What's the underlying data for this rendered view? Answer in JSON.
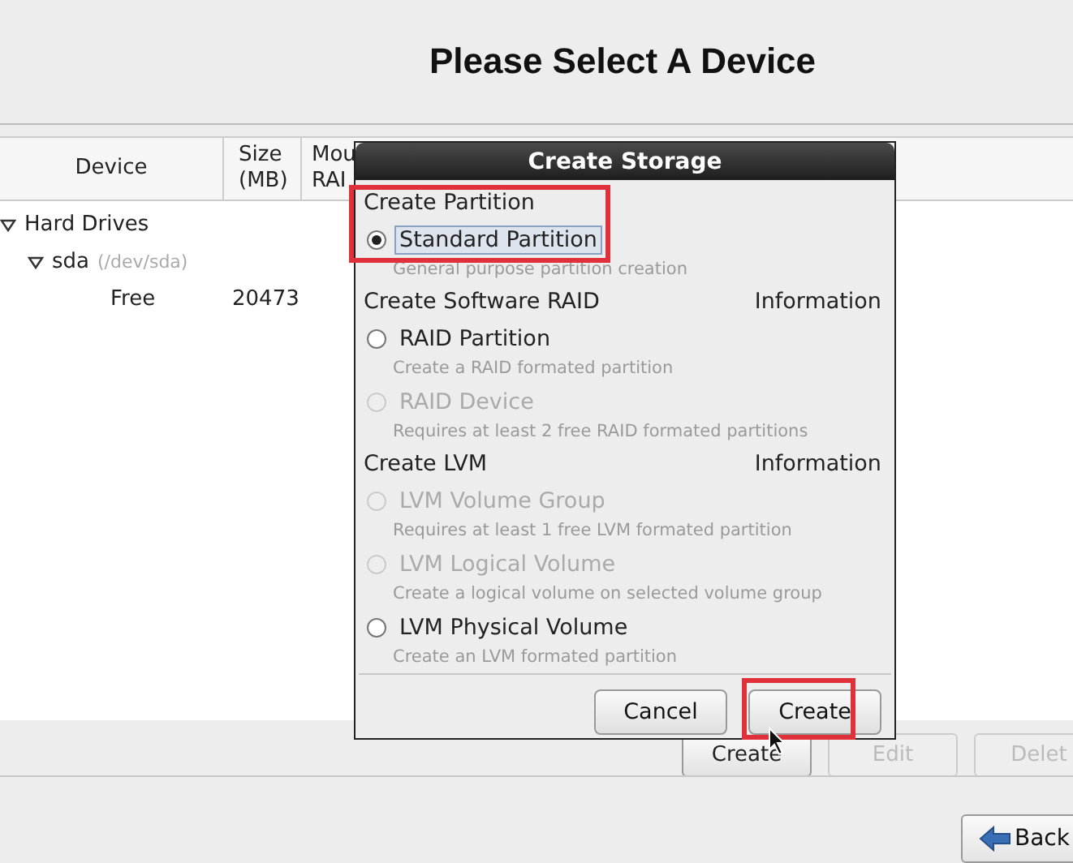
{
  "header": {
    "title": "Please Select A Device"
  },
  "table": {
    "columns": [
      {
        "lines": [
          "Device"
        ]
      },
      {
        "lines": [
          "Size",
          "(MB)"
        ]
      },
      {
        "lines": [
          "Mou",
          "RAI"
        ]
      }
    ],
    "rows": [
      {
        "label": "Hard Drives",
        "expanded": true,
        "children": [
          {
            "label": "sda",
            "detail": "(/dev/sda)",
            "expanded": true,
            "children": [
              {
                "label": "Free",
                "size": "20473"
              }
            ]
          }
        ]
      }
    ]
  },
  "actions": [
    {
      "label": "Create",
      "disabled": false
    },
    {
      "label": "Edit",
      "disabled": true
    },
    {
      "label": "Delet",
      "disabled": true
    }
  ],
  "nav": {
    "back": "Back"
  },
  "dialog": {
    "title": "Create Storage",
    "sections": [
      {
        "heading": "Create Partition",
        "options": [
          {
            "label": "Standard Partition",
            "description": "General purpose partition creation",
            "selected": true,
            "disabled": false,
            "highlighted": true
          }
        ]
      },
      {
        "heading": "Create Software RAID",
        "info": "Information",
        "options": [
          {
            "label": "RAID Partition",
            "description": "Create a RAID formated partition",
            "selected": false,
            "disabled": false,
            "highlighted": false
          },
          {
            "label": "RAID Device",
            "description": "Requires at least 2 free RAID formated partitions",
            "selected": false,
            "disabled": true,
            "highlighted": false
          }
        ]
      },
      {
        "heading": "Create LVM",
        "info": "Information",
        "options": [
          {
            "label": "LVM Volume Group",
            "description": "Requires at least 1 free LVM formated partition",
            "selected": false,
            "disabled": true,
            "highlighted": false
          },
          {
            "label": "LVM Logical Volume",
            "description": "Create a logical volume on selected volume group",
            "selected": false,
            "disabled": true,
            "highlighted": false
          },
          {
            "label": "LVM Physical Volume",
            "description": "Create an LVM formated partition",
            "selected": false,
            "disabled": false,
            "highlighted": false
          }
        ]
      }
    ],
    "buttons": [
      {
        "label": "Cancel",
        "highlighted": false
      },
      {
        "label": "Create",
        "highlighted": true
      }
    ]
  }
}
